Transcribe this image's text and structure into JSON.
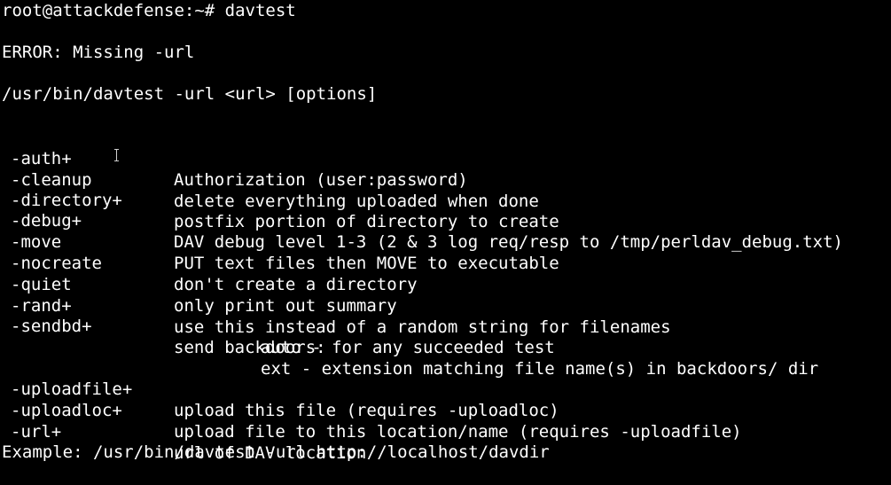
{
  "prompt": "root@attackdefense:~# davtest",
  "error": "ERROR: Missing -url",
  "usage": "/usr/bin/davtest -url <url> [options]",
  "options": [
    {
      "name": "-auth+",
      "desc": "Authorization (user:password)"
    },
    {
      "name": "-cleanup",
      "desc": "delete everything uploaded when done"
    },
    {
      "name": "-directory+",
      "desc": "postfix portion of directory to create"
    },
    {
      "name": "-debug+",
      "desc": "DAV debug level 1-3 (2 & 3 log req/resp to /tmp/perldav_debug.txt)"
    },
    {
      "name": "-move",
      "desc": "PUT text files then MOVE to executable"
    },
    {
      "name": "-nocreate",
      "desc": "don't create a directory"
    },
    {
      "name": "-quiet",
      "desc": "only print out summary"
    },
    {
      "name": "-rand+",
      "desc": "use this instead of a random string for filenames"
    },
    {
      "name": "-sendbd+",
      "desc": "send backdoors:"
    }
  ],
  "sendbd_sub": [
    "auto - for any succeeded test",
    "ext - extension matching file name(s) in backdoors/ dir"
  ],
  "options2": [
    {
      "name": "-uploadfile+",
      "desc": "upload this file (requires -uploadloc)"
    },
    {
      "name": "-uploadloc+",
      "desc": "upload file to this location/name (requires -uploadfile)"
    },
    {
      "name": "-url+",
      "desc": "url of DAV location"
    }
  ],
  "example": "Example: /usr/bin/davtest -url http://localhost/davdir",
  "colors": {
    "background": "#000000",
    "foreground": "#ffffff"
  }
}
